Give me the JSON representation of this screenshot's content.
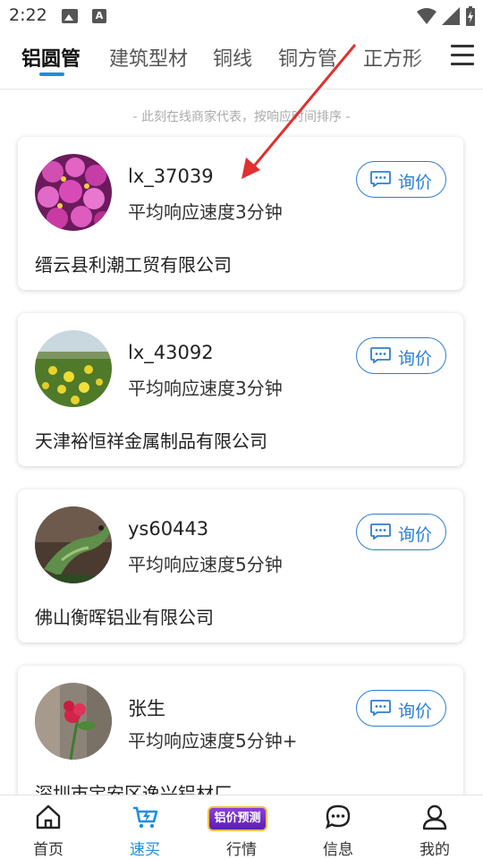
{
  "status_bar": {
    "time": "2:22"
  },
  "tabs": [
    {
      "label": "铝圆管",
      "active": true
    },
    {
      "label": "建筑型材",
      "active": false
    },
    {
      "label": "铜线",
      "active": false
    },
    {
      "label": "铜方管",
      "active": false
    },
    {
      "label": "正方形",
      "active": false
    }
  ],
  "section": {
    "subtitle": "- 此刻在线商家代表，按响应时间排序 -"
  },
  "merchants": [
    {
      "name": "lx_37039",
      "speed": "平均响应速度3分钟",
      "company": "缙云县利潮工贸有限公司",
      "button": "询价",
      "avatar": "pink-flowers-photo"
    },
    {
      "name": "lx_43092",
      "speed": "平均响应速度3分钟",
      "company": "天津裕恒祥金属制品有限公司",
      "button": "询价",
      "avatar": "yellow-flower-field-photo"
    },
    {
      "name": "ys60443",
      "speed": "平均响应速度5分钟",
      "company": "佛山衡晖铝业有限公司",
      "button": "询价",
      "avatar": "lizard-photo"
    },
    {
      "name": "张生",
      "speed": "平均响应速度5分钟+",
      "company": "深圳市宝安区逸兴铝材厂",
      "button": "询价",
      "avatar": "red-flower-photo"
    }
  ],
  "bottom_nav": [
    {
      "label": "首页",
      "icon": "home-icon",
      "active": false
    },
    {
      "label": "速买",
      "icon": "quick-buy-icon",
      "active": true
    },
    {
      "label": "行情",
      "icon": "price-forecast-badge",
      "badge": "铝价预测",
      "active": false
    },
    {
      "label": "信息",
      "icon": "chat-icon",
      "active": false
    },
    {
      "label": "我的",
      "icon": "profile-icon",
      "active": false
    }
  ],
  "colors": {
    "accent": "#1a8fe0",
    "button_border": "#2b7fd4",
    "annotation_arrow": "#e03030",
    "badge_purple": "#6a28c4",
    "badge_gold": "#f0c14b"
  }
}
